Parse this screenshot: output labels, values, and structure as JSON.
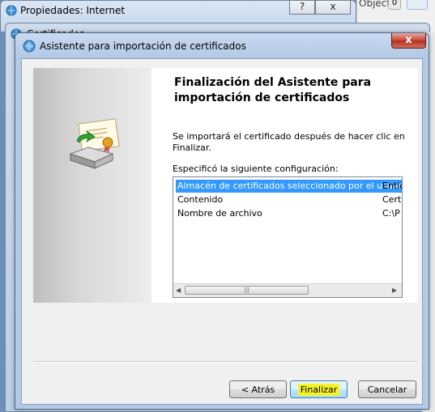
{
  "background_window_1": {
    "title": "Propiedades: Internet",
    "help_label": "?",
    "close_label": "x"
  },
  "background_window_2": {
    "title": "Certificados"
  },
  "background_right": {
    "objects_text": "Objects",
    "badge_count": "0"
  },
  "dialog": {
    "title": "Asistente para importación de certificados",
    "close_label": "x",
    "heading": "Finalización del Asistente para importación de certificados",
    "message": "Se importará el certificado después de hacer clic en Finalizar.",
    "config_label": "Especificó la siguiente configuración:",
    "config_rows": [
      {
        "name": "Almacén de certificados seleccionado por el usuario",
        "value": "Entid"
      },
      {
        "name": "Contenido",
        "value": "Certi"
      },
      {
        "name": "Nombre de archivo",
        "value": "C:\\P"
      }
    ],
    "buttons": {
      "back": "< Atrás",
      "finish": "Finalizar",
      "cancel": "Cancelar"
    }
  },
  "colors": {
    "selection": "#3399ff",
    "highlight": "#f7f32a",
    "close_red": "#c7463a"
  },
  "icons": [
    "internet-options-icon",
    "certificate-wizard-icon",
    "certificate-import-art"
  ]
}
